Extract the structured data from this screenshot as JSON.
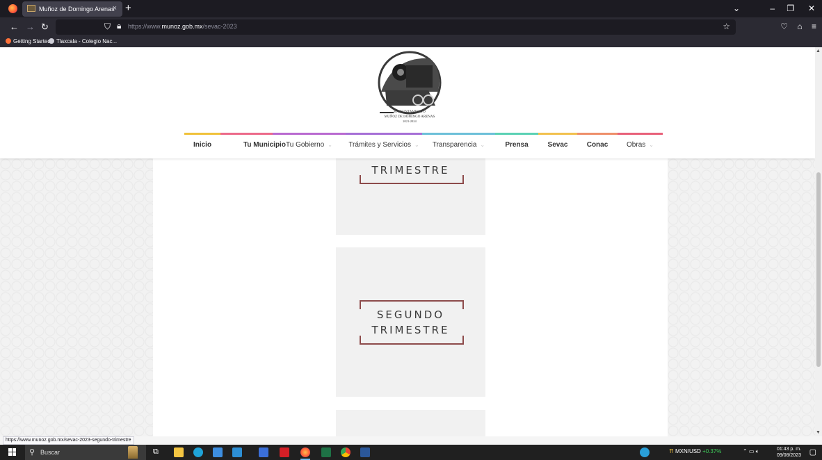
{
  "browser": {
    "tab_title": "Muñoz de Domingo Arenas",
    "tab_close": "×",
    "new_tab": "+",
    "url_prefix": "https://www.",
    "url_domain": "munoz.gob.mx",
    "url_path": "/sevac-2023",
    "bookmarks": [
      "Getting Started",
      "Tlaxcala - Colegio Nac..."
    ],
    "status_url": "https://www.munoz.gob.mx/sevac-2023-segundo-trimestre"
  },
  "site": {
    "logo_lines": [
      "H. AYUNTAMIENTO",
      "MUÑOZ DE DOMINGO ARENAS",
      "2021-2024"
    ],
    "menu": [
      {
        "label": "Inicio",
        "color": "#f0c23b"
      },
      {
        "label": "Tu Municipio",
        "color": "#ec6a8a"
      },
      {
        "label": "Tu Gobierno",
        "color": "#b96ad0"
      },
      {
        "label": "Trámites y Servicios",
        "color": "#a66fd6"
      },
      {
        "label": "Transparencia",
        "color": "#6cc0d9"
      },
      {
        "label": "Prensa",
        "color": "#5bd1b4"
      },
      {
        "label": "Sevac",
        "color": "#f2c14e"
      },
      {
        "label": "Conac",
        "color": "#ee8f6a"
      },
      {
        "label": "Obras",
        "color": "#e8617a"
      }
    ],
    "cards": [
      {
        "lines": [
          "TRIMESTRE"
        ]
      },
      {
        "lines": [
          "SEGUNDO",
          "TRIMESTRE"
        ]
      }
    ]
  },
  "taskbar": {
    "search_placeholder": "Buscar",
    "ticker_label": "MXN/USD",
    "ticker_change": "+0.37%",
    "time": "01:43 p. m.",
    "date": "09/08/2023"
  },
  "colors": {
    "accent_bracket": "#8d4b4b",
    "browser_dark": "#1c1b22"
  }
}
